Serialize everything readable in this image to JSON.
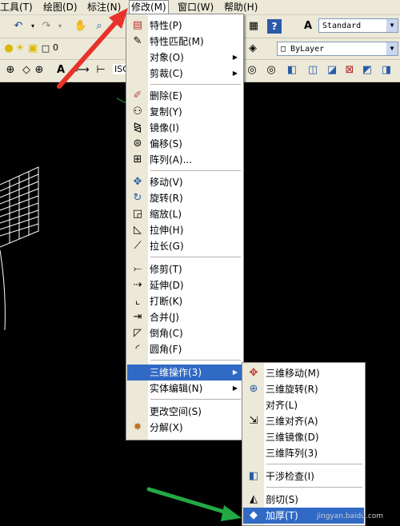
{
  "menubar": {
    "items": [
      "工具(T)",
      "绘图(D)",
      "标注(N)",
      "修改(M)",
      "窗口(W)",
      "帮助(H)"
    ]
  },
  "toolbar": {
    "text_style": "Standard",
    "layer_value": "0",
    "linetype": "ByLayer",
    "dim_style_partial": "ISO"
  },
  "modify_menu": {
    "items": [
      {
        "label": "特性(P)",
        "icon": "properties-icon"
      },
      {
        "label": "特性匹配(M)",
        "icon": "match-brush-icon"
      },
      {
        "label": "对象(O)",
        "submenu": "▶"
      },
      {
        "label": "剪裁(C)",
        "submenu": "▶"
      },
      {
        "label": "删除(E)",
        "icon": "eraser-icon"
      },
      {
        "label": "复制(Y)",
        "icon": "copy-icon"
      },
      {
        "label": "镜像(I)",
        "icon": "mirror-icon"
      },
      {
        "label": "偏移(S)",
        "icon": "offset-icon"
      },
      {
        "label": "阵列(A)...",
        "icon": "array-icon"
      },
      {
        "label": "移动(V)",
        "icon": "move-icon"
      },
      {
        "label": "旋转(R)",
        "icon": "rotate-icon"
      },
      {
        "label": "缩放(L)",
        "icon": "scale-icon"
      },
      {
        "label": "拉伸(H)",
        "icon": "stretch-icon"
      },
      {
        "label": "拉长(G)",
        "icon": "lengthen-icon"
      },
      {
        "label": "修剪(T)",
        "icon": "trim-icon"
      },
      {
        "label": "延伸(D)",
        "icon": "extend-icon"
      },
      {
        "label": "打断(K)",
        "icon": "break-icon"
      },
      {
        "label": "合并(J)",
        "icon": "join-icon"
      },
      {
        "label": "倒角(C)",
        "icon": "chamfer-icon"
      },
      {
        "label": "圆角(F)",
        "icon": "fillet-icon"
      },
      {
        "label": "三维操作(3)",
        "submenu": "▶"
      },
      {
        "label": "实体编辑(N)",
        "submenu": "▶"
      },
      {
        "label": "更改空间(S)"
      },
      {
        "label": "分解(X)",
        "icon": "explode-icon"
      }
    ]
  },
  "submenu_3d": {
    "items": [
      {
        "label": "三维移动(M)",
        "icon": "3d-move-icon"
      },
      {
        "label": "三维旋转(R)",
        "icon": "3d-rotate-icon"
      },
      {
        "label": "对齐(L)"
      },
      {
        "label": "三维对齐(A)",
        "icon": "3d-align-icon"
      },
      {
        "label": "三维镜像(D)"
      },
      {
        "label": "三维阵列(3)"
      },
      {
        "label": "干涉检查(I)",
        "icon": "interference-icon"
      },
      {
        "label": "剖切(S)",
        "icon": "slice-icon"
      },
      {
        "label": "加厚(T)",
        "icon": "thicken-icon"
      }
    ]
  },
  "watermark": "jingyan.baidu.com",
  "colors": {
    "highlight": "#316AC5",
    "menu_bg": "#FFFFFF",
    "gutter": "#ECE9D8",
    "canvas": "#000000",
    "annot_red": "#E8322A",
    "annot_green": "#22A845"
  }
}
